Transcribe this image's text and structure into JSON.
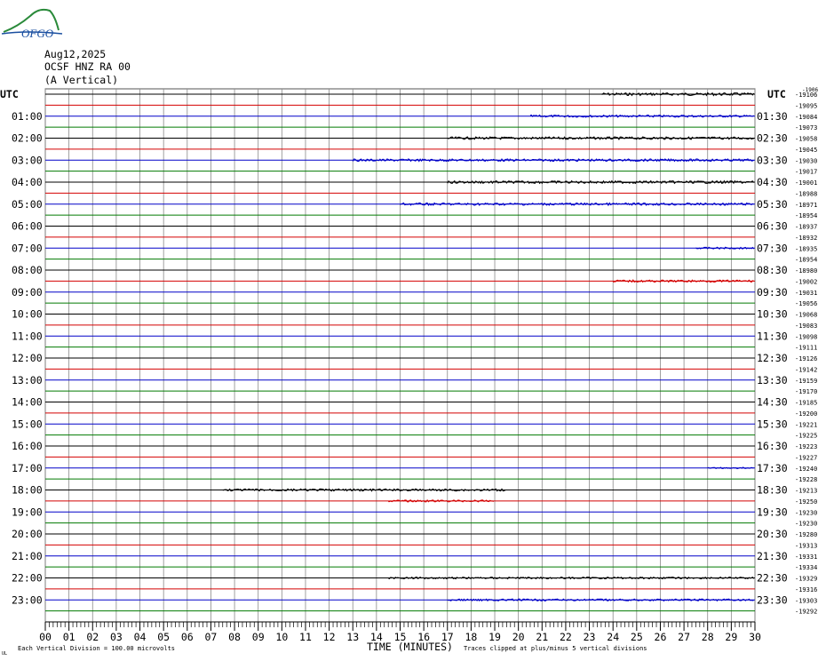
{
  "header": {
    "date": "Aug12,2025",
    "station": "OCSF HNZ RA 00",
    "component": "(A Vertical)"
  },
  "logo": {
    "text": "OFGO",
    "colors": [
      "#2a8a3a",
      "#1a4fa0"
    ]
  },
  "footer": {
    "scale_note": "Each Vertical Division =  100.00 microvolts",
    "xlabel": "TIME (MINUTES)",
    "clip_note": "Traces clipped at plus/minus 5 vertical divisions",
    "corner_mark": "UL"
  },
  "chart_data": {
    "type": "line",
    "title": "",
    "left_axis_title": "UTC",
    "right_axis_title": "UTC",
    "right_top_small": "-1906",
    "xlabel": "TIME (MINUTES)",
    "xlim": [
      0,
      30
    ],
    "x_ticks": [
      "00",
      "01",
      "02",
      "03",
      "04",
      "05",
      "06",
      "07",
      "08",
      "09",
      "10",
      "11",
      "12",
      "13",
      "14",
      "15",
      "16",
      "17",
      "18",
      "19",
      "20",
      "21",
      "22",
      "23",
      "24",
      "25",
      "26",
      "27",
      "28",
      "29",
      "30"
    ],
    "trace_colors": [
      "#000000",
      "#d40000",
      "#0000c8",
      "#007a00"
    ],
    "grid": true,
    "left_labels": [
      "01:00",
      "02:00",
      "03:00",
      "04:00",
      "05:00",
      "06:00",
      "07:00",
      "08:00",
      "09:00",
      "10:00",
      "11:00",
      "12:00",
      "13:00",
      "14:00",
      "15:00",
      "16:00",
      "17:00",
      "18:00",
      "19:00",
      "20:00",
      "21:00",
      "22:00",
      "23:00"
    ],
    "right_labels": [
      "01:30",
      "02:30",
      "03:30",
      "04:30",
      "05:30",
      "06:30",
      "07:30",
      "08:30",
      "09:30",
      "10:30",
      "11:30",
      "12:30",
      "13:30",
      "14:30",
      "15:30",
      "16:30",
      "17:30",
      "18:30",
      "19:30",
      "20:30",
      "21:30",
      "22:30",
      "23:30"
    ],
    "trace_offsets": [
      "-19106",
      "-19095",
      "-19084",
      "-19073",
      "-19058",
      "-19045",
      "-19030",
      "-19017",
      "-19001",
      "-18988",
      "-18971",
      "-18954",
      "-18937",
      "-18932",
      "-18935",
      "-18954",
      "-18980",
      "-19002",
      "-19031",
      "-19056",
      "-19068",
      "-19083",
      "-19098",
      "-19111",
      "-19126",
      "-19142",
      "-19159",
      "-19170",
      "-19185",
      "-19200",
      "-19221",
      "-19225",
      "-19223",
      "-19227",
      "-19240",
      "-19228",
      "-19213",
      "-19250",
      "-19230",
      "-19230",
      "-19280",
      "-19313",
      "-19331",
      "-19334",
      "-19329",
      "-19316",
      "-19303",
      "-19292"
    ],
    "trace_activity": [
      {
        "line": 0,
        "start": 23.5,
        "end": 30,
        "amp": 1.5
      },
      {
        "line": 2,
        "start": 20.5,
        "end": 30,
        "amp": 1.2
      },
      {
        "line": 4,
        "start": 17,
        "end": 30,
        "amp": 1.4
      },
      {
        "line": 6,
        "start": 13,
        "end": 30,
        "amp": 1.3
      },
      {
        "line": 8,
        "start": 17,
        "end": 30,
        "amp": 1.4
      },
      {
        "line": 10,
        "start": 15,
        "end": 30,
        "amp": 1.3
      },
      {
        "line": 14,
        "start": 27.5,
        "end": 30,
        "amp": 1.0
      },
      {
        "line": 17,
        "start": 24,
        "end": 30,
        "amp": 1.2
      },
      {
        "line": 36,
        "start": 7.5,
        "end": 19.5,
        "amp": 1.2
      },
      {
        "line": 37,
        "start": 14.5,
        "end": 19,
        "amp": 1.0
      },
      {
        "line": 44,
        "start": 14.5,
        "end": 30,
        "amp": 1.0
      },
      {
        "line": 46,
        "start": 17,
        "end": 30,
        "amp": 1.1
      },
      {
        "line": 34,
        "start": 28,
        "end": 30,
        "amp": 0.8
      }
    ]
  }
}
